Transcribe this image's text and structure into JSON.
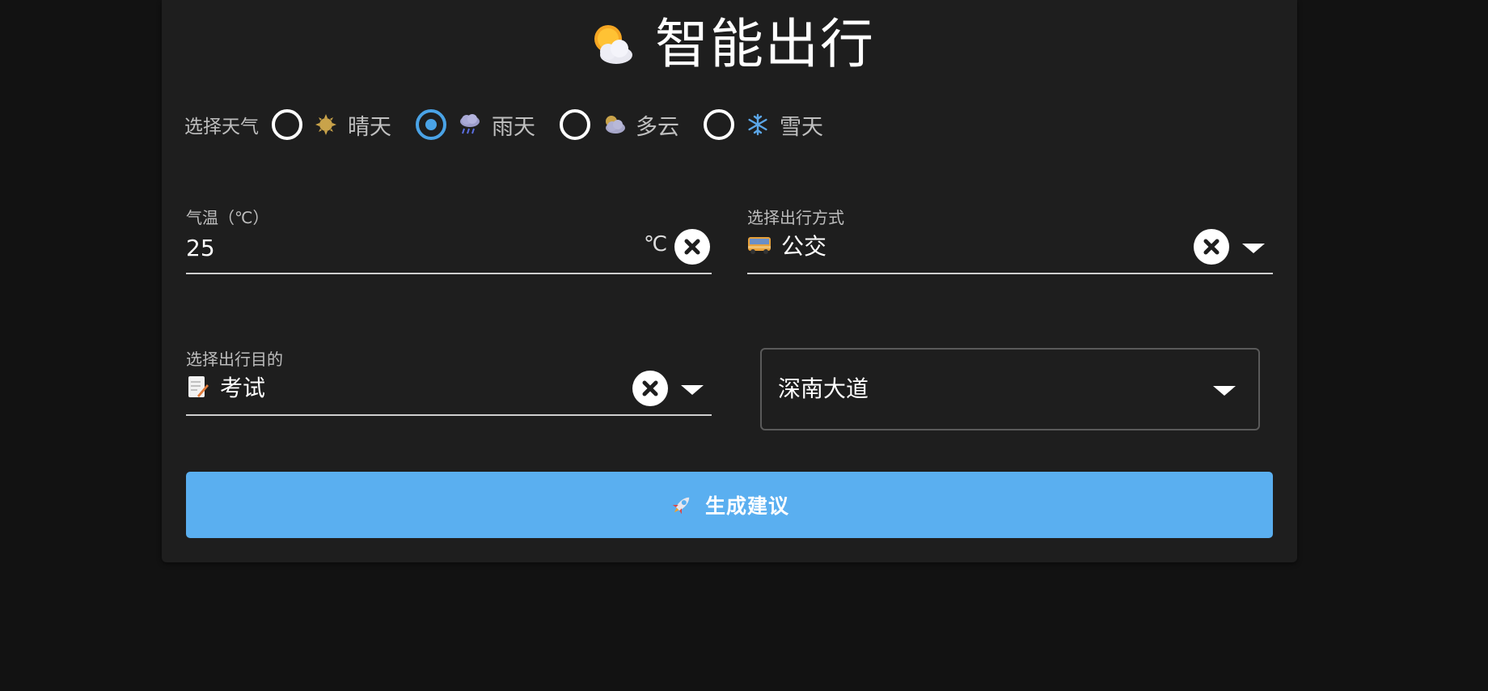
{
  "app": {
    "title": "智能出行",
    "title_icon": "sun-behind-cloud-icon"
  },
  "weather": {
    "legend": "选择天气",
    "selected": "雨天",
    "options": [
      {
        "label": "晴天",
        "icon": "sun-icon",
        "checked": false
      },
      {
        "label": "雨天",
        "icon": "rain-cloud-icon",
        "checked": true
      },
      {
        "label": "多云",
        "icon": "cloudy-icon",
        "checked": false
      },
      {
        "label": "雪天",
        "icon": "snowflake-icon",
        "checked": false
      }
    ]
  },
  "temperature": {
    "label": "气温（℃）",
    "value": "25",
    "unit": "℃"
  },
  "transport": {
    "label": "选择出行方式",
    "value": "公交",
    "icon": "bus-icon"
  },
  "purpose": {
    "label": "选择出行目的",
    "value": "考试",
    "icon": "memo-icon"
  },
  "location": {
    "value": "深南大道"
  },
  "generate": {
    "label": "生成建议",
    "icon": "rocket-icon"
  },
  "colors": {
    "accent": "#5aaff0",
    "radio_checked": "#4aa3e6",
    "card_bg": "#1e1e1e",
    "page_bg": "#121212"
  }
}
